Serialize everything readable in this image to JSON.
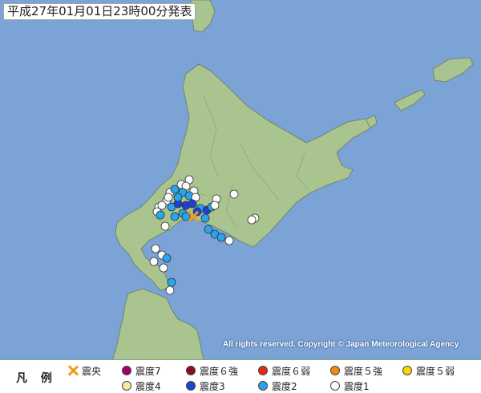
{
  "title": "平成27年01月01日23時00分発表",
  "copyright": "All rights reserved. Copyright © Japan Meteorological Agency",
  "legend": {
    "heading": "凡 例",
    "epicenter": "震央",
    "items": [
      {
        "label": "震度7",
        "color": "#a0006e"
      },
      {
        "label": "震度６強",
        "color": "#8a0f1f"
      },
      {
        "label": "震度６弱",
        "color": "#e8290f"
      },
      {
        "label": "震度５強",
        "color": "#f08a10"
      },
      {
        "label": "震度５弱",
        "color": "#f5d800"
      },
      {
        "label": "震度4",
        "color": "#f5eaa6"
      },
      {
        "label": "震度3",
        "color": "#1f3fd9"
      },
      {
        "label": "震度2",
        "color": "#27a6ef"
      },
      {
        "label": "震度1",
        "color": "#ffffff"
      }
    ]
  },
  "colors": {
    "sea": "#7ba3d6",
    "land": "#a9c48f",
    "epicenter": "#f39a1d"
  }
}
